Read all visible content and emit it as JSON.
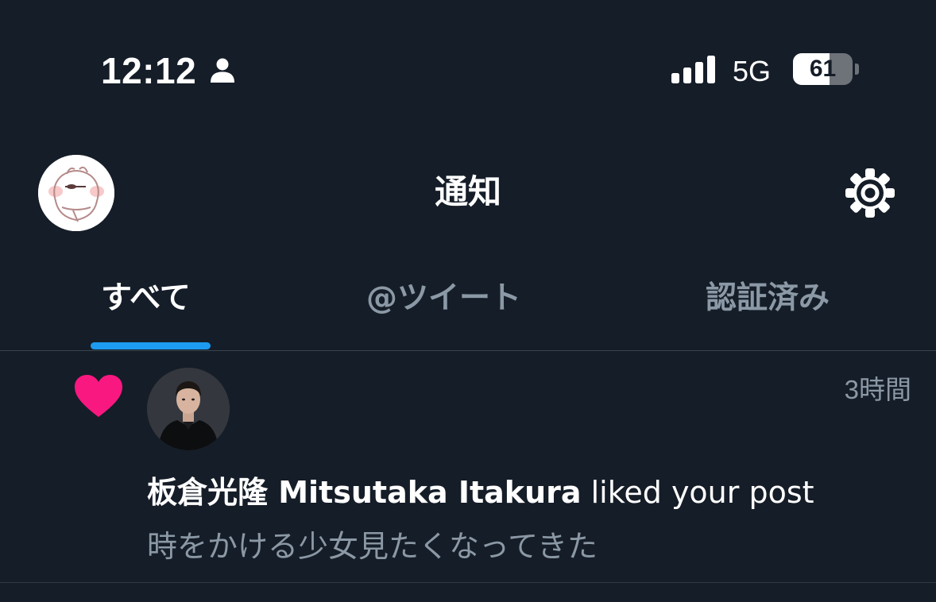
{
  "status_bar": {
    "time": "12:12",
    "focus_icon": "person-icon",
    "signal_icon": "cellular-signal-icon",
    "network": "5G",
    "battery_level": "61",
    "battery_fraction": 0.61
  },
  "header": {
    "title": "通知",
    "avatar_icon": "profile-avatar",
    "settings_icon": "gear-icon"
  },
  "tabs": [
    {
      "label": "すべて",
      "active": true
    },
    {
      "label": "@ツイート",
      "active": false
    },
    {
      "label": "認証済み",
      "active": false
    }
  ],
  "notification": {
    "type_icon": "heart-icon",
    "user_name": "板倉光隆 Mitsutaka Itakura",
    "action": " liked your post",
    "timestamp": "3時間",
    "preview": "時をかける少女見たくなってきた"
  },
  "colors": {
    "background": "#151d28",
    "accent": "#1d9bf0",
    "like": "#f91880",
    "muted_text": "#8b98a5",
    "divider": "#38444d"
  }
}
